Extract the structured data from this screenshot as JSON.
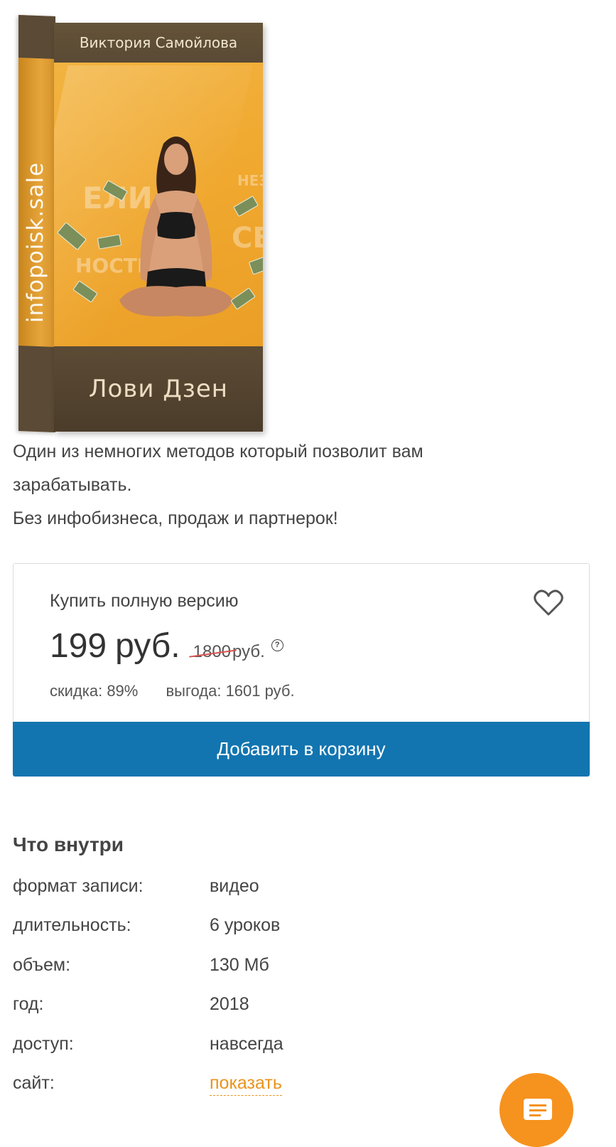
{
  "product": {
    "author": "Виктория Самойлова",
    "side_text": "infopoisk.sale",
    "box_title": "Лови Дзен"
  },
  "description": {
    "line1": "Один из немногих методов который позволит вам",
    "line2": "зарабатывать.",
    "line3": "Без инфобизнеса, продаж и партнерок!"
  },
  "buy": {
    "title": "Купить полную версию",
    "price": "199",
    "price_unit": "руб.",
    "old_price": "1800",
    "old_price_unit": "руб.",
    "help": "?",
    "discount": "скидка: 89%",
    "benefit": "выгода: 1601 руб.",
    "add_to_cart": "Добавить в корзину"
  },
  "specs": {
    "title": "Что внутри",
    "rows": [
      {
        "label": "формат записи:",
        "value": "видео"
      },
      {
        "label": "длительность:",
        "value": "6 уроков"
      },
      {
        "label": "объем:",
        "value": "130 Мб"
      },
      {
        "label": "год:",
        "value": "2018"
      },
      {
        "label": "доступ:",
        "value": "навсегда"
      },
      {
        "label": "сайт:",
        "value": "показать"
      }
    ]
  },
  "colors": {
    "accent_blue": "#1275b0",
    "link_orange": "#e9931e",
    "chat_orange": "#f6921e",
    "strike_red": "#d9534f"
  },
  "icons": {
    "favorite": "heart-icon",
    "help": "question-icon",
    "chat": "chat-icon"
  }
}
